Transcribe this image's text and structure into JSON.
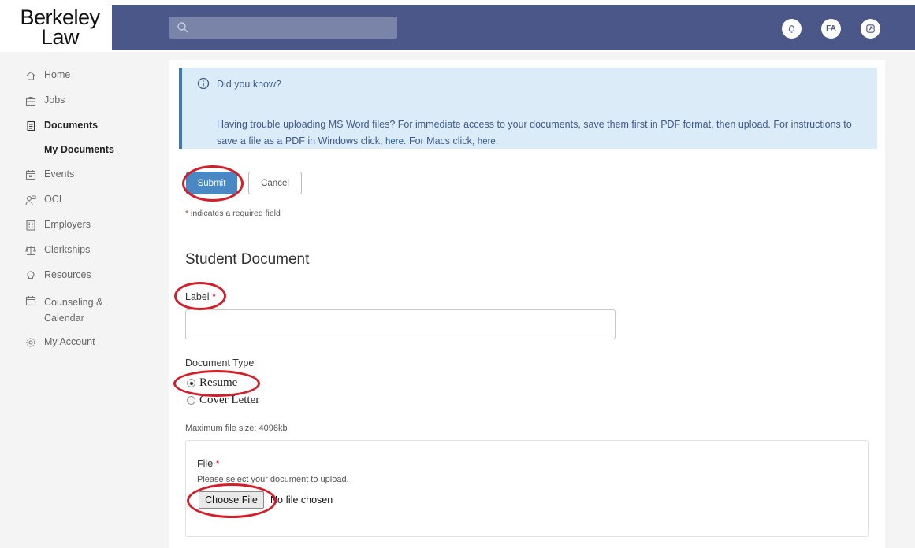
{
  "header": {
    "logo_line1": "Berkeley",
    "logo_line2": "Law",
    "search_placeholder": "",
    "buttons": [
      {
        "name": "notifications",
        "label": ""
      },
      {
        "name": "user-avatar",
        "label": "FA"
      },
      {
        "name": "external",
        "label": ""
      }
    ]
  },
  "sidebar": {
    "items": [
      {
        "label": "Home",
        "icon": "home-icon"
      },
      {
        "label": "Jobs",
        "icon": "briefcase-icon"
      },
      {
        "label": "Documents",
        "icon": "document-icon"
      },
      {
        "label": "Events",
        "icon": "calendar-icon"
      },
      {
        "label": "OCI",
        "icon": "people-icon"
      },
      {
        "label": "Employers",
        "icon": "building-icon"
      },
      {
        "label": "Clerkships",
        "icon": "scales-icon"
      },
      {
        "label": "Resources",
        "icon": "lightbulb-icon"
      },
      {
        "label": "Counseling &",
        "label2": "Calendar",
        "icon": "calendar-icon"
      },
      {
        "label": "My Account",
        "icon": "gear-icon"
      }
    ],
    "sub_item": "My Documents"
  },
  "info": {
    "title": "Did you know?",
    "body_prefix": "Having trouble uploading MS Word files? For immediate access to your documents, save them first in PDF format, then upload. For instructions to save a file as a PDF in Windows click,",
    "link1": "here",
    "body_middle": ". For Macs click,",
    "link2": "here",
    "body_suffix": "."
  },
  "form": {
    "submit_label": "Submit",
    "cancel_label": "Cancel",
    "required_note": "indicates a required field",
    "required_star": "*",
    "section_title": "Student Document",
    "label_field": "Label",
    "label_value": "",
    "doc_type_label": "Document Type",
    "doc_types": [
      {
        "label": "Resume",
        "checked": true
      },
      {
        "label": "Cover Letter",
        "checked": false
      }
    ],
    "max_size": "Maximum file size: 4096kb",
    "file_label": "File",
    "file_hint": "Please select your document to upload.",
    "choose_file": "Choose File",
    "no_file": "No file chosen"
  },
  "colors": {
    "header_bg": "#4b5788",
    "accent": "#4a88c4",
    "info_bg": "#dcebf8",
    "annotation": "#d21f2a"
  }
}
